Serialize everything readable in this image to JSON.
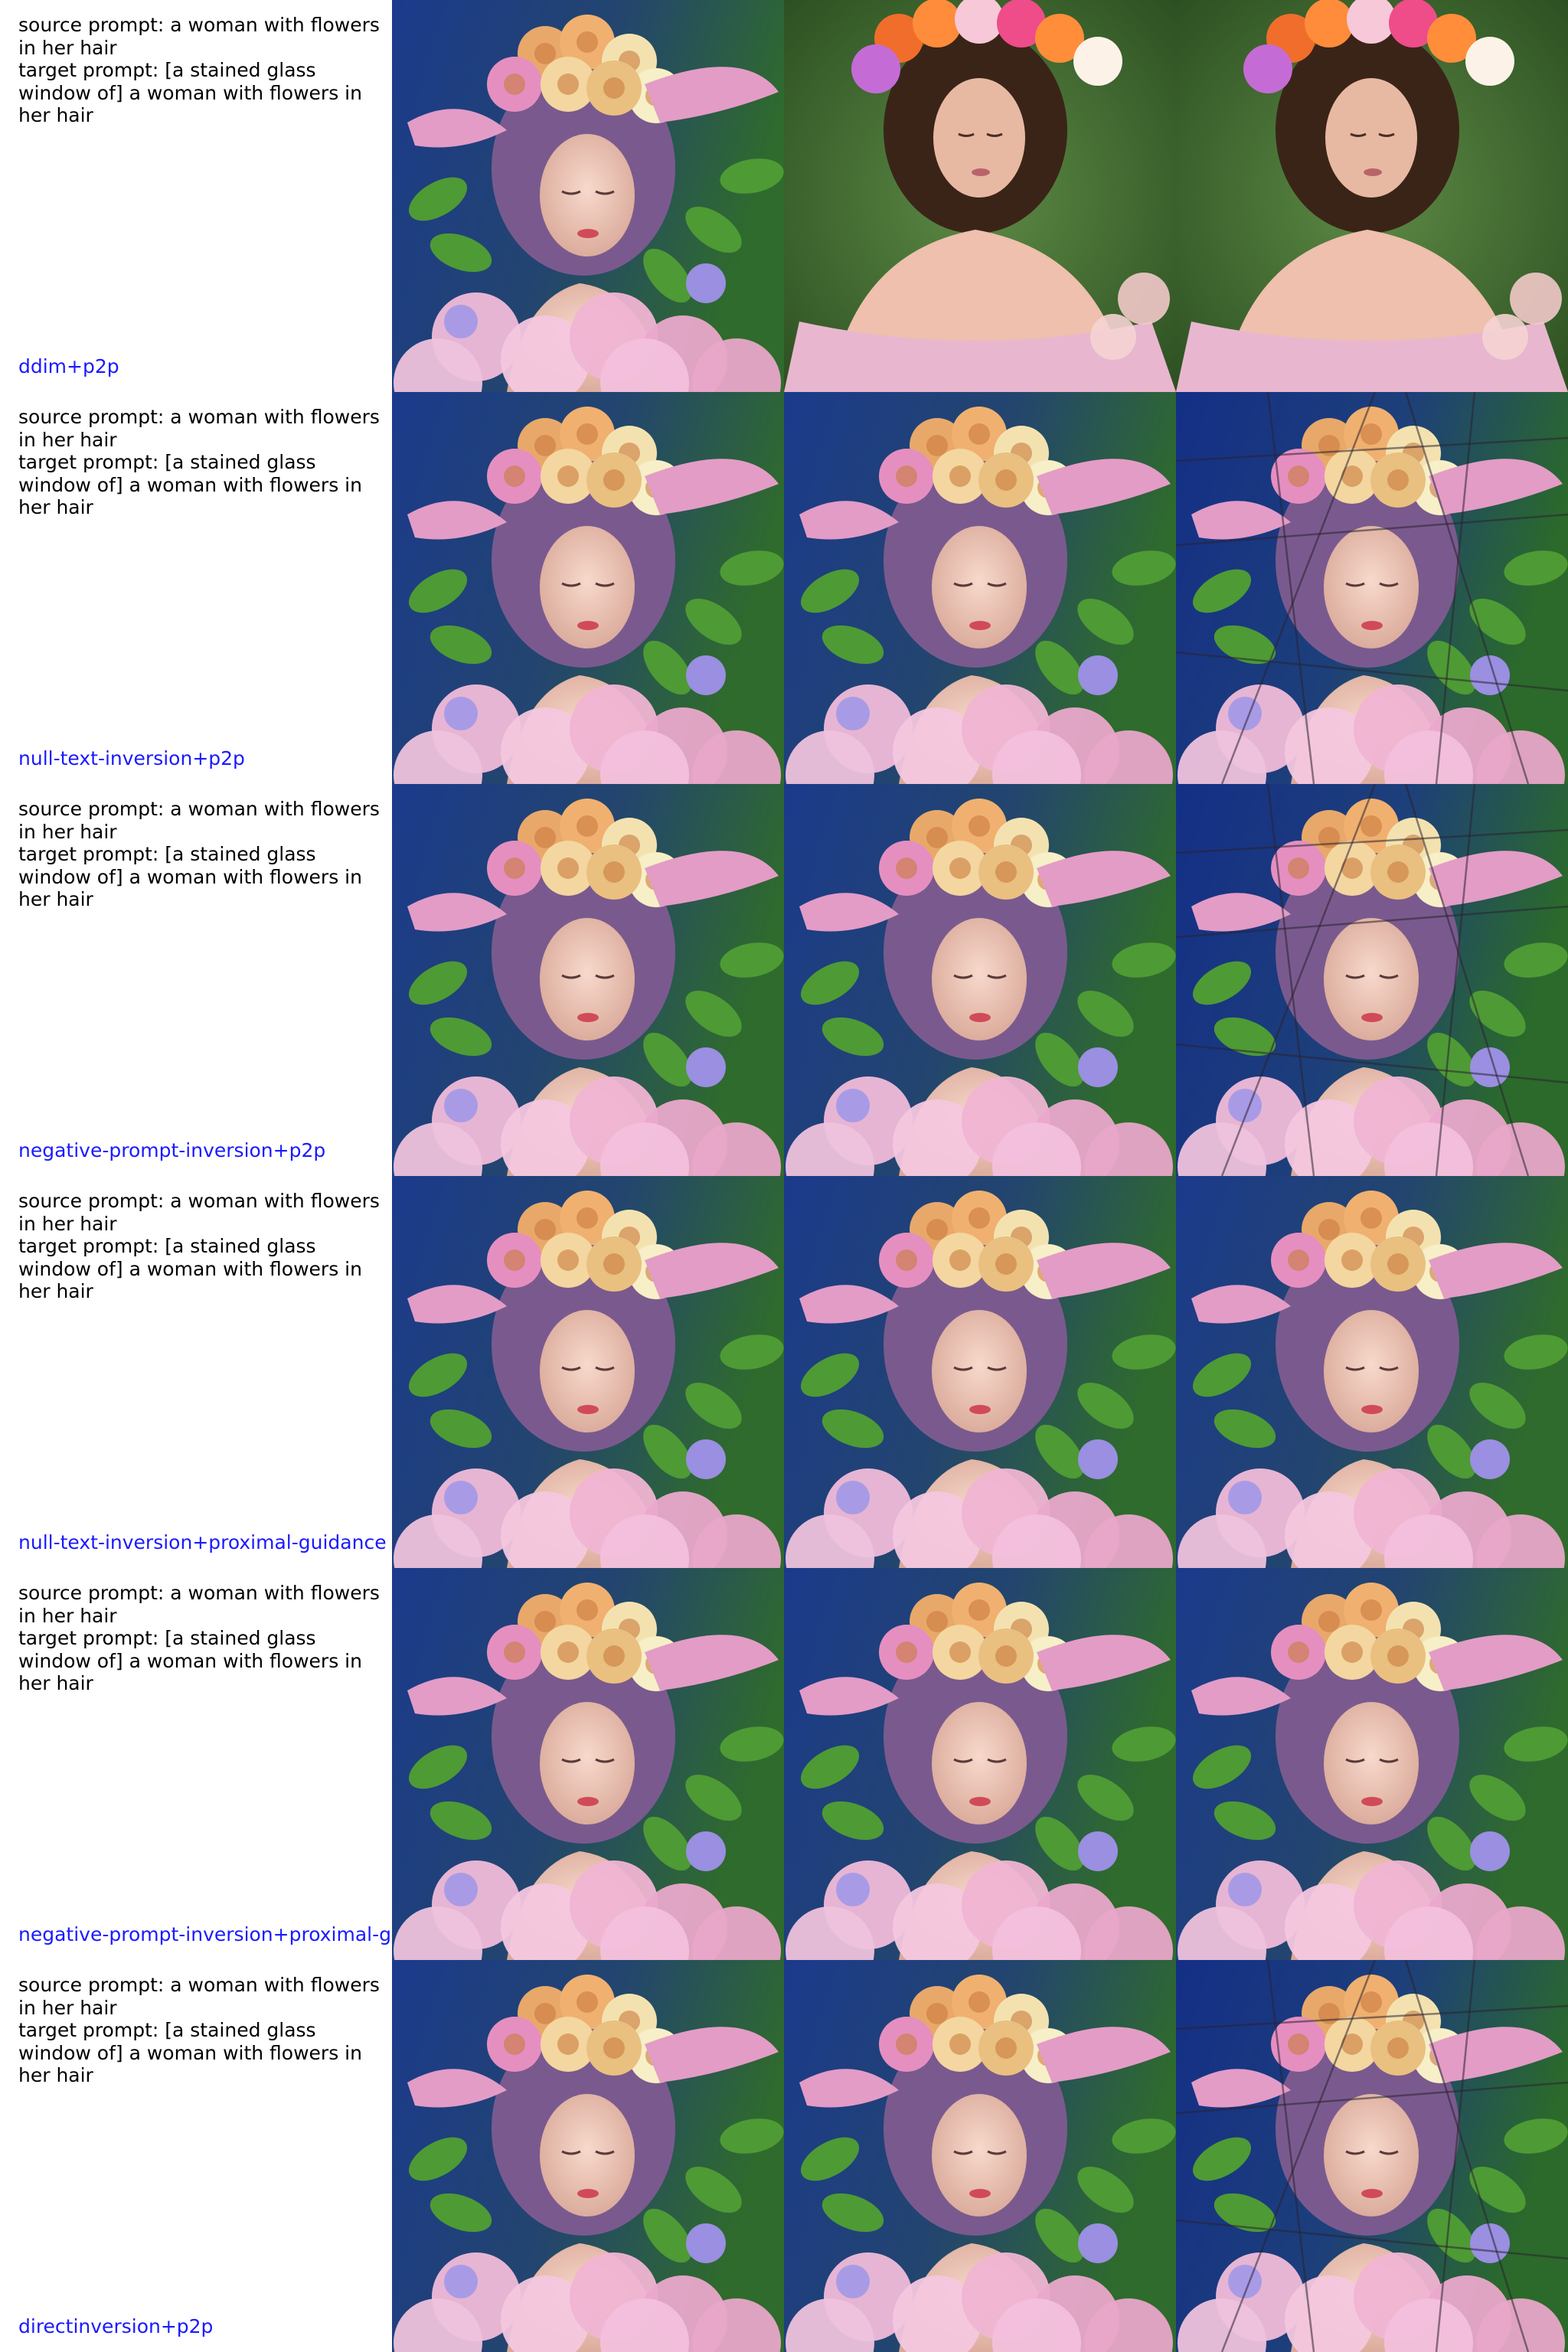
{
  "rows": [
    {
      "source_prompt": "source prompt: a woman with flowers in her hair",
      "target_prompt": "target prompt: [a stained glass window of] a woman with flowers in her hair",
      "method": "ddim+p2p",
      "images": [
        {
          "kind": "painting"
        },
        {
          "kind": "photo"
        },
        {
          "kind": "photo"
        }
      ]
    },
    {
      "source_prompt": "source prompt: a woman with flowers in her hair",
      "target_prompt": "target prompt: [a stained glass window of] a woman with flowers in her hair",
      "method": "null-text-inversion+p2p",
      "images": [
        {
          "kind": "painting"
        },
        {
          "kind": "painting"
        },
        {
          "kind": "stained-glass"
        }
      ]
    },
    {
      "source_prompt": "source prompt: a woman with flowers in her hair",
      "target_prompt": "target prompt: [a stained glass window of] a woman with flowers in her hair",
      "method": "negative-prompt-inversion+p2p",
      "images": [
        {
          "kind": "painting"
        },
        {
          "kind": "painting"
        },
        {
          "kind": "stained-glass"
        }
      ]
    },
    {
      "source_prompt": "source prompt: a woman with flowers in her hair",
      "target_prompt": "target prompt: [a stained glass window of] a woman with flowers in her hair",
      "method": "null-text-inversion+proximal-guidance",
      "images": [
        {
          "kind": "painting"
        },
        {
          "kind": "painting"
        },
        {
          "kind": "painting"
        }
      ]
    },
    {
      "source_prompt": "source prompt: a woman with flowers in her hair",
      "target_prompt": "target prompt: [a stained glass window of] a woman with flowers in her hair",
      "method": "negative-prompt-inversion+proximal-g",
      "images": [
        {
          "kind": "painting"
        },
        {
          "kind": "painting"
        },
        {
          "kind": "painting"
        }
      ]
    },
    {
      "source_prompt": "source prompt: a woman with flowers in her hair",
      "target_prompt": "target prompt: [a stained glass window of] a woman with flowers in her hair",
      "method": "directinversion+p2p",
      "images": [
        {
          "kind": "painting"
        },
        {
          "kind": "painting"
        },
        {
          "kind": "stained-glass"
        }
      ]
    }
  ],
  "colors": {
    "method_label": "#1a1aff",
    "prompt_text": "#000000",
    "painting_bg_left": "#1b3a8c",
    "painting_bg_right": "#2f6b2c",
    "photo_bg": "#3f6a2e",
    "stained_bg": "#17358f"
  }
}
